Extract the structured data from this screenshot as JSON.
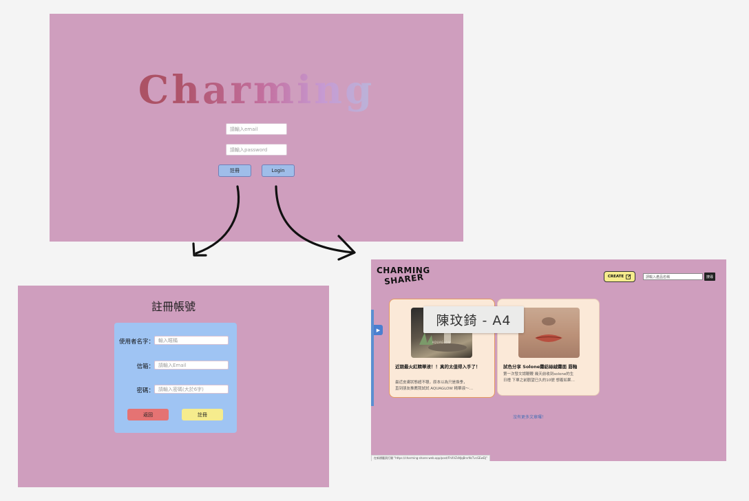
{
  "login": {
    "title": "Charming",
    "email_placeholder": "請輸入email",
    "password_placeholder": "請輸入password",
    "register_label": "註冊",
    "login_label": "Login"
  },
  "register": {
    "title": "註冊帳號",
    "username_label": "使用者名字：",
    "username_placeholder": "輸入暱稱",
    "email_label": "信箱：",
    "email_placeholder": "請輸入Email",
    "password_label": "密碼：",
    "password_placeholder": "請輸入密碼(大於6字)",
    "back_label": "返回",
    "submit_label": "註冊"
  },
  "sharer": {
    "logo_line1": "CHARMING",
    "logo_line2": "SHARER",
    "create_label": "CREATE",
    "search_placeholder": "請輸入產品名稱",
    "search_label": "搜尋",
    "cards": [
      {
        "title": "近期最火紅精華液！！真的太值得入手了！",
        "excerpt_line1": "最近皮膚狀態超不穩，原本以為只是換季，",
        "excerpt_line2": "直到朋友推薦我試試 AQUAGLOW 精華液～…",
        "image_caption": "AQUAGLOW",
        "image_alt": "serum product photo"
      },
      {
        "title": "試色分享 Solone霧紡絲絨霧面 唇釉",
        "excerpt_line1": "第一次發文請鞭鞭 幾天前收到solone的生",
        "excerpt_line2": "日禮 下單之前觀望已久的10號 想着如果…",
        "image_alt": "lip tint swatch photo"
      }
    ],
    "no_more_label": "沒有更多文章囉！",
    "status_url": "在新標籤頁打開 \"https://charming-sharer.web.app/post/FhXVZsNJqBrsrNcTvcGEwDj\""
  },
  "overlay_label": "陳玟錡 - A4",
  "icons": {
    "edit": "edit-icon",
    "sidebar_toggle": "play-icon"
  },
  "colors": {
    "panel_background": "#cf9ebe",
    "primary_button": "#9fbde9",
    "form_background": "#9fc4f3",
    "back_button": "#e57373",
    "submit_button": "#f6ec8d",
    "card_background": "#fbe9d8"
  }
}
